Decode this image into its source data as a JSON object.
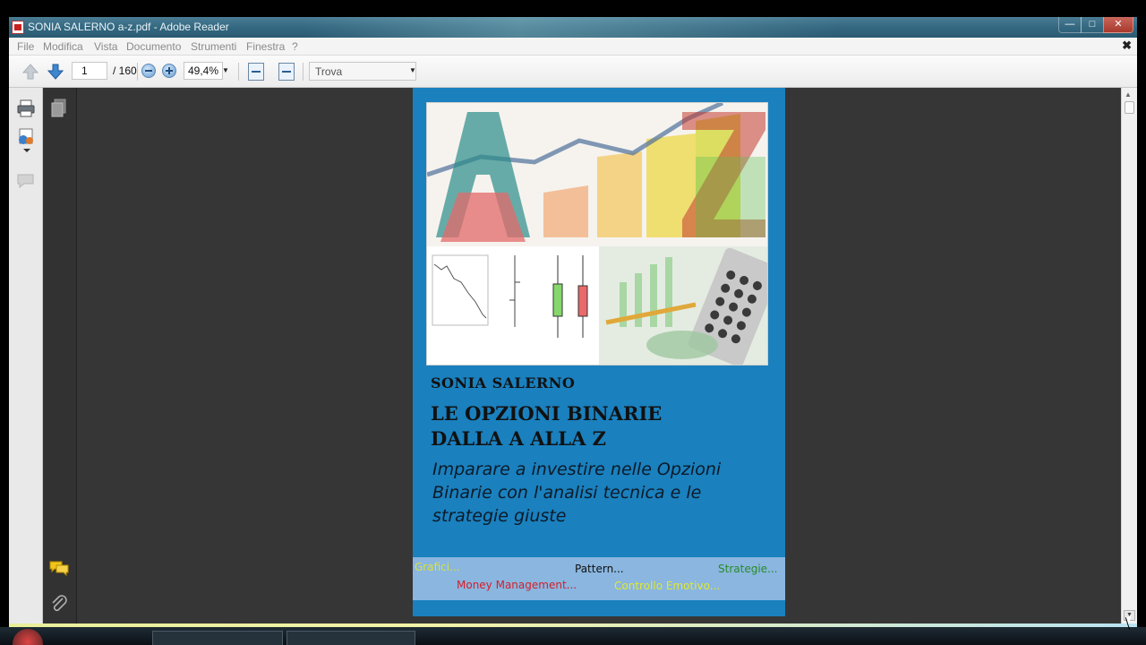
{
  "window": {
    "title": "SONIA SALERNO a-z.pdf - Adobe Reader",
    "min_label": "—",
    "max_label": "□",
    "close_label": "✕"
  },
  "menubar": {
    "items": [
      "File",
      "Modifica",
      "Vista",
      "Documento",
      "Strumenti",
      "Finestra",
      "?"
    ],
    "close_label": "✖"
  },
  "toolbar": {
    "page_current": "1",
    "page_total": "/ 160",
    "zoom": "49,4%",
    "find_placeholder": "Trova",
    "dropdown_glyph": "▼"
  },
  "sidepanel": {
    "icons": [
      "printer-icon",
      "share-icon",
      "comment-bubble-icon",
      "pages-icon",
      "comments-icon",
      "attachment-icon"
    ]
  },
  "page": {
    "author": "SONIA SALERNO",
    "title_line1": "LE OPZIONI BINARIE",
    "title_line2": "DALLA A ALLA Z",
    "subtitle_lines": [
      "Imparare a investire nelle Opzioni",
      "Binarie con l'analisi tecnica e le",
      "strategie giuste"
    ],
    "tags": {
      "grafici": "Grafici...",
      "pattern": "Pattern...",
      "strategie": "Strategie...",
      "money": "Money Management...",
      "controllo": "Controllo Emotivo..."
    },
    "colors": {
      "cover_blue": "#1a80be",
      "tag_band": "#8ab6e0",
      "grafici": "#d8e23a",
      "pattern": "#111111",
      "strategie": "#2a8a2a",
      "money": "#d41f2a",
      "controllo": "#e0e832"
    }
  }
}
